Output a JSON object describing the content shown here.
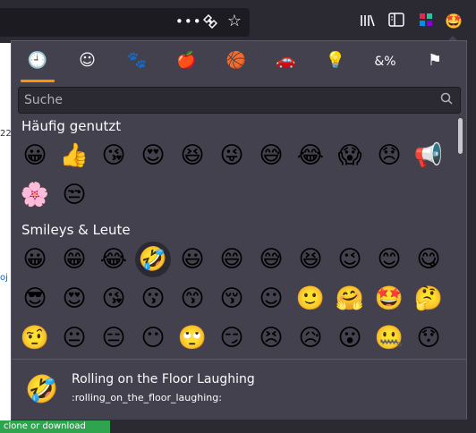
{
  "toolbar": {
    "icons": [
      "more-dots-icon",
      "extensions-icon",
      "bookmark-star-icon",
      "library-icon",
      "sidebar-icon",
      "extension-grid-icon",
      "emoji-picker-icon"
    ]
  },
  "page": {
    "fragment_left_a": "22",
    "fragment_left_b": "oj",
    "green_button_text": "clone or download"
  },
  "picker": {
    "tabs": [
      {
        "name": "recent",
        "glyph": "🕘"
      },
      {
        "name": "smileys",
        "glyph": "☺"
      },
      {
        "name": "animals",
        "glyph": "🐾"
      },
      {
        "name": "food",
        "glyph": "🍎"
      },
      {
        "name": "activities",
        "glyph": "🏀"
      },
      {
        "name": "travel",
        "glyph": "🚗"
      },
      {
        "name": "objects",
        "glyph": "💡"
      },
      {
        "name": "symbols",
        "glyph": "&%"
      },
      {
        "name": "flags",
        "glyph": "⚑"
      }
    ],
    "active_tab": 0,
    "search": {
      "placeholder": "Suche",
      "value": ""
    },
    "sections": [
      {
        "title": "Häufig genutzt",
        "rows": [
          [
            "😀",
            "👍",
            "😘",
            "😍",
            "😆",
            "😜",
            "😅",
            "😂",
            "😱",
            "😞",
            "📢"
          ],
          [
            "🌸",
            "😒"
          ]
        ]
      },
      {
        "title": "Smileys & Leute",
        "rows": [
          [
            "😀",
            "😁",
            "😂",
            "🤣",
            "😃",
            "😄",
            "😅",
            "😆",
            "😉",
            "😊",
            "😋"
          ],
          [
            "😎",
            "😍",
            "😘",
            "😗",
            "😙",
            "😚",
            "☺",
            "🙂",
            "🤗",
            "🤩",
            "🤔"
          ],
          [
            "🤨",
            "😐",
            "😑",
            "😶",
            "🙄",
            "😏",
            "😣",
            "😥",
            "😮",
            "🤐",
            "😯"
          ]
        ]
      }
    ],
    "hovered": {
      "section": 1,
      "row": 0,
      "col": 3
    },
    "preview": {
      "glyph": "🤣",
      "name": "Rolling on the Floor Laughing",
      "shortcode": ":rolling_on_the_floor_laughing:"
    }
  }
}
